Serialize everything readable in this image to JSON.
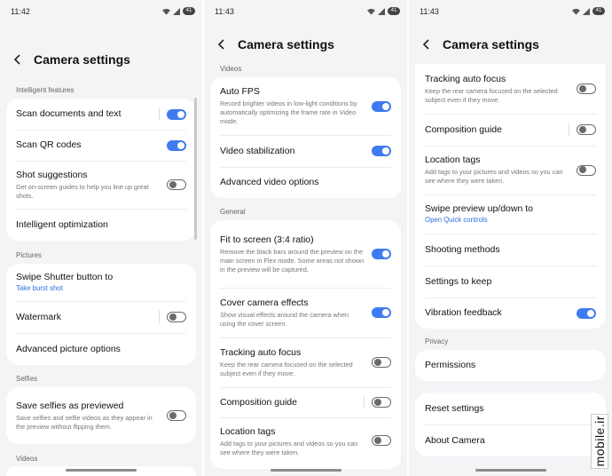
{
  "screens": [
    {
      "time": "11:42",
      "battery": "41",
      "title": "Camera settings",
      "sections": {
        "intelligent": "Intelligent features",
        "pictures": "Pictures",
        "selfies": "Selfies",
        "videos": "Videos"
      },
      "items": {
        "scan_documents": "Scan documents and text",
        "scan_qr": "Scan QR codes",
        "shot_suggestions": "Shot suggestions",
        "shot_suggestions_sub": "Get on-screen guides to help you line up great shots.",
        "intelligent_optimization": "Intelligent optimization",
        "swipe_shutter": "Swipe Shutter button to",
        "swipe_shutter_value": "Take burst shot",
        "watermark": "Watermark",
        "advanced_picture": "Advanced picture options",
        "save_selfies": "Save selfies as previewed",
        "save_selfies_sub": "Save selfies and selfie videos as they appear in the preview without flipping them."
      }
    },
    {
      "time": "11:43",
      "battery": "41",
      "title": "Camera settings",
      "sections": {
        "videos": "Videos",
        "general": "General"
      },
      "items": {
        "auto_fps": "Auto FPS",
        "auto_fps_sub": "Record brighter videos in low-light conditions by automatically optimizing the frame rate in Video mode.",
        "video_stabilization": "Video stabilization",
        "advanced_video": "Advanced video options",
        "fit_to_screen": "Fit to screen (3:4 ratio)",
        "fit_to_screen_sub": "Remove the black bars around the preview on the main screen in Flex mode. Some areas not shown in the preview will be captured.",
        "cover_effects": "Cover camera effects",
        "cover_effects_sub": "Show visual effects around the camera when using the cover screen.",
        "tracking_af": "Tracking auto focus",
        "tracking_af_sub": "Keep the rear camera focused on the selected subject even if they move.",
        "composition_guide": "Composition guide",
        "location_tags": "Location tags",
        "location_tags_sub": "Add tags to your pictures and videos so you can see where they were taken."
      }
    },
    {
      "time": "11:43",
      "battery": "41",
      "title": "Camera settings",
      "sections": {
        "privacy": "Privacy"
      },
      "items": {
        "tracking_af": "Tracking auto focus",
        "tracking_af_sub": "Keep the rear camera focused on the selected subject even if they move.",
        "composition_guide": "Composition guide",
        "location_tags": "Location tags",
        "location_tags_sub": "Add tags to your pictures and videos so you can see where they were taken.",
        "swipe_preview": "Swipe preview up/down to",
        "swipe_preview_value": "Open Quick controls",
        "shooting_methods": "Shooting methods",
        "settings_to_keep": "Settings to keep",
        "vibration_feedback": "Vibration feedback",
        "permissions": "Permissions",
        "reset_settings": "Reset settings",
        "about_camera": "About Camera"
      }
    }
  ],
  "watermark_text": "mobile.ir",
  "colors": {
    "accent": "#3e7bf0",
    "link": "#2f6fdd",
    "background": "#f4f4f7",
    "card": "#ffffff"
  }
}
